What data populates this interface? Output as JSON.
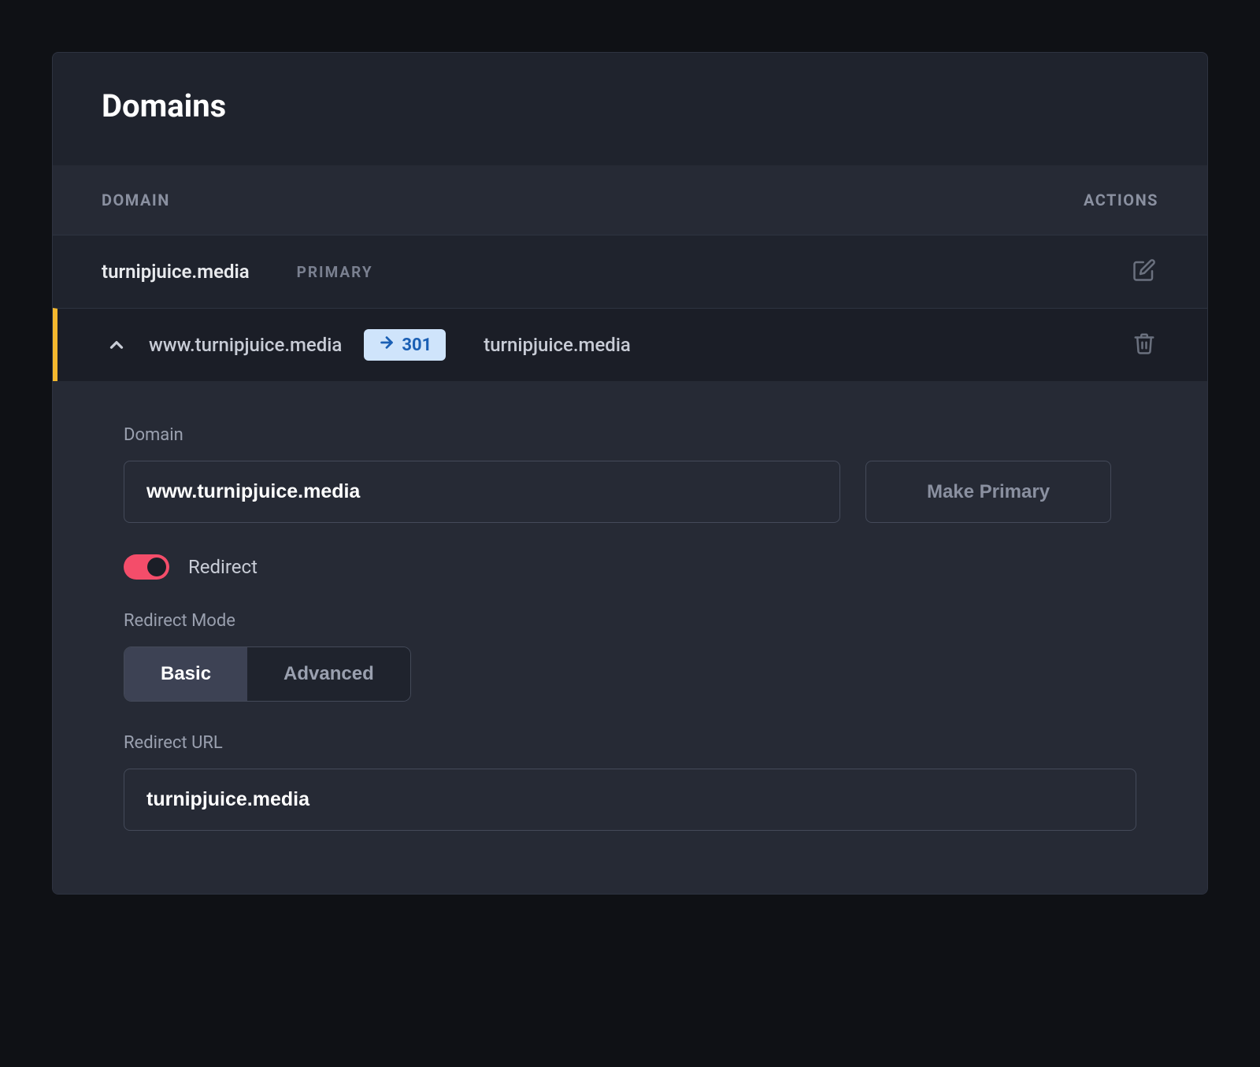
{
  "panel": {
    "title": "Domains"
  },
  "columns": {
    "domain": "DOMAIN",
    "actions": "ACTIONS"
  },
  "primaryRow": {
    "domain": "turnipjuice.media",
    "badge": "PRIMARY"
  },
  "redirectRow": {
    "source": "www.turnipjuice.media",
    "code": "301",
    "target": "turnipjuice.media"
  },
  "form": {
    "domainLabel": "Domain",
    "domainValue": "www.turnipjuice.media",
    "makePrimary": "Make Primary",
    "redirectToggleLabel": "Redirect",
    "redirectOn": true,
    "modeLabel": "Redirect Mode",
    "modeBasic": "Basic",
    "modeAdvanced": "Advanced",
    "redirectUrlLabel": "Redirect URL",
    "redirectUrlValue": "turnipjuice.media"
  },
  "colors": {
    "accent": "#f5b82e",
    "toggleOn": "#f44d6a",
    "badgeBg": "#cfe4fb",
    "badgeFg": "#1a5fb4"
  }
}
